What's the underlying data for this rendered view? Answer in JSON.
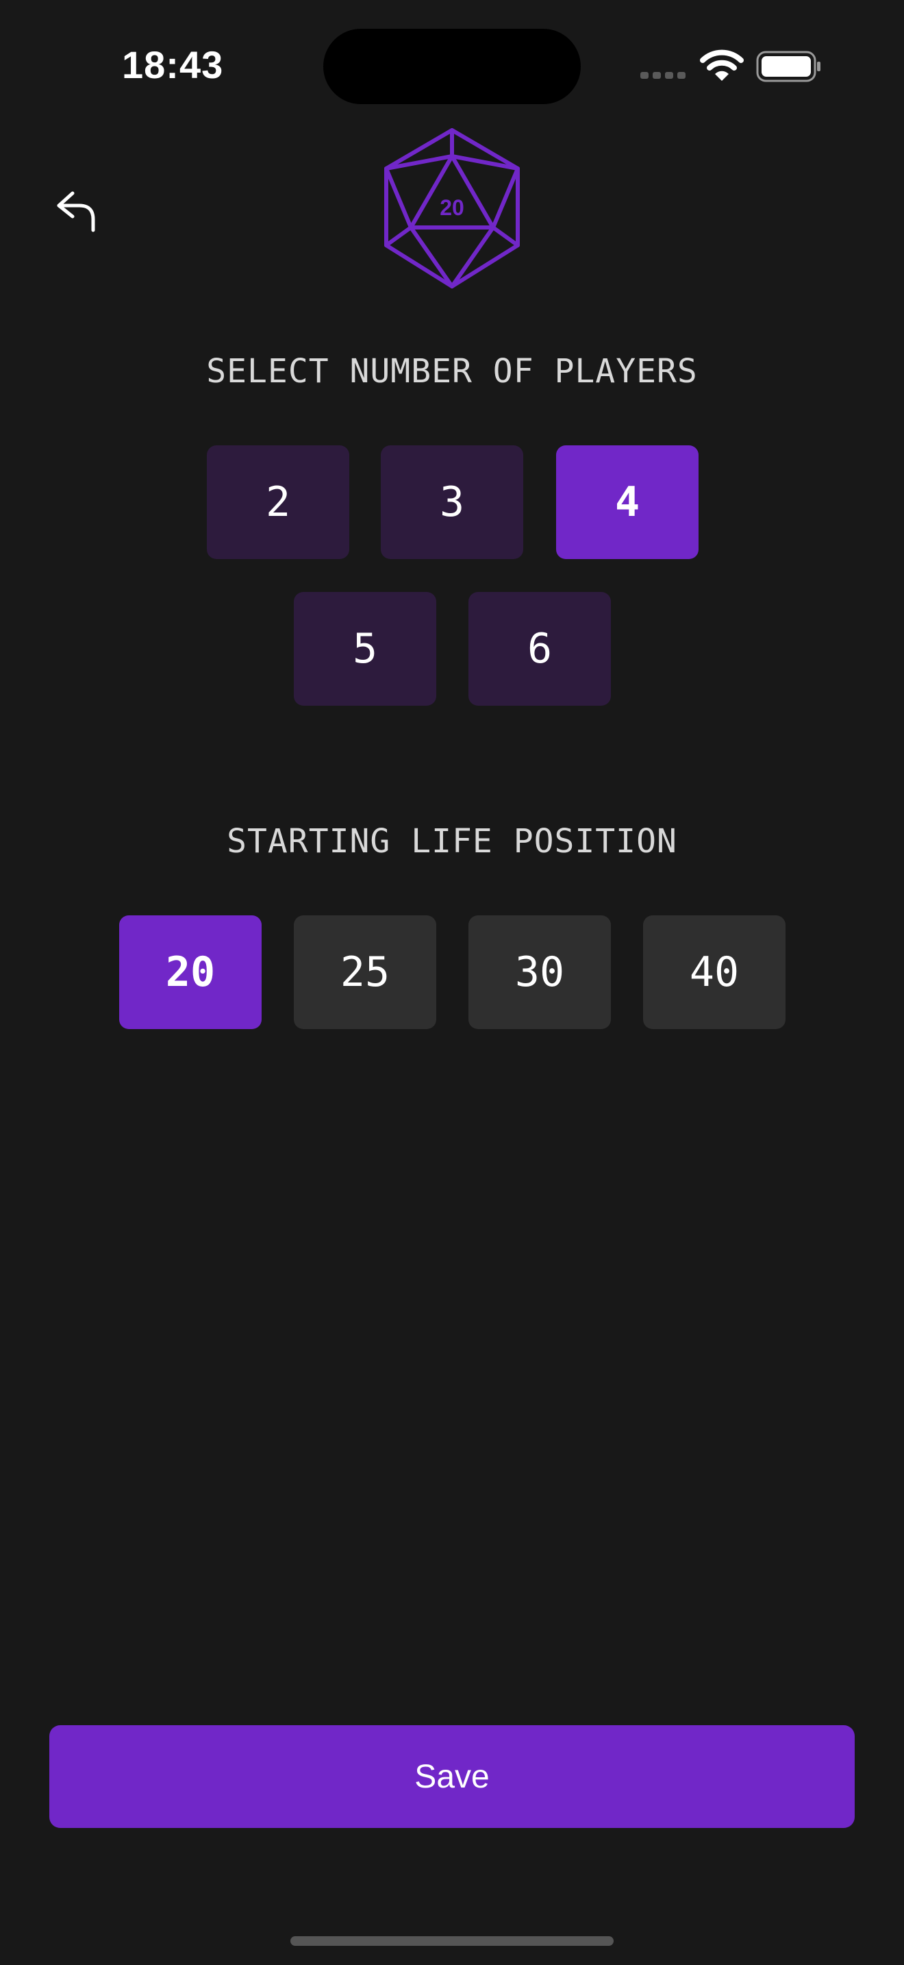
{
  "status_bar": {
    "time": "18:43"
  },
  "header": {
    "back_icon": "undo-arrow-icon",
    "logo_icon": "d20-die-icon",
    "logo_text": "20"
  },
  "players": {
    "heading": "SELECT NUMBER OF PLAYERS",
    "options": [
      "2",
      "3",
      "4",
      "5",
      "6"
    ],
    "selected": "4"
  },
  "life": {
    "heading": "STARTING LIFE POSITION",
    "options": [
      "20",
      "25",
      "30",
      "40"
    ],
    "selected": "20"
  },
  "save_label": "Save",
  "colors": {
    "accent": "#7127c8",
    "background": "#181818",
    "player_option_bg": "#2d1b3d",
    "life_option_bg": "#2f2f2f"
  }
}
